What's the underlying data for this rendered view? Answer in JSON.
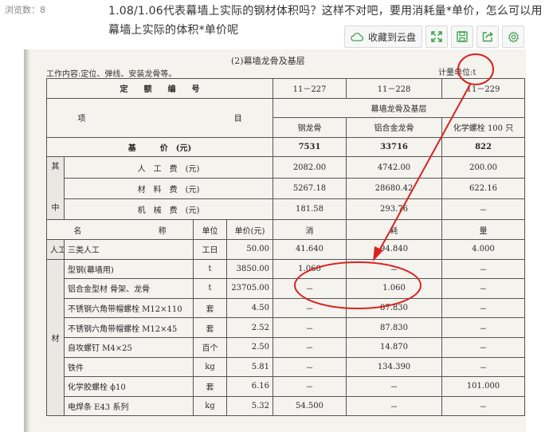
{
  "header": {
    "views": "浏览数：8",
    "question": "1.08/1.06代表幕墙上实际的钢材体积吗？这样不对吧，要用消耗量*单价，怎么可以用幕墙上实际的体积*单价呢"
  },
  "toolbar": {
    "save_cloud_label": "收藏到云盘",
    "icons": [
      "cloud-icon",
      "fullscreen-icon",
      "save-icon",
      "share-icon",
      "settings-icon"
    ],
    "accent_color": "#3fa34d"
  },
  "document": {
    "title": "(2)幕墙龙骨及基层",
    "work_content": "工作内容:定位、弹线、安装龙骨等。",
    "unit": "计量单位:t",
    "table": {
      "code_label": "定　　额　　编　　号",
      "codes": [
        "11－227",
        "11－228",
        "11－229"
      ],
      "item_label": "项",
      "item_label2": "目",
      "group_header": "幕墙龙骨及基层",
      "subheaders": [
        "钢龙骨",
        "铝合金龙骨",
        "化学螺栓 100 只"
      ],
      "base_price_label": "基　　　价　(元)",
      "base_prices": [
        "7531",
        "33716",
        "822"
      ],
      "among_label": [
        "其",
        "中"
      ],
      "cost_rows": [
        {
          "label": "人　工　费　(元)",
          "values": [
            "2082.00",
            "4742.00",
            "200.00"
          ]
        },
        {
          "label": "材　料　费　(元)",
          "values": [
            "5267.18",
            "28680.42",
            "622.16"
          ]
        },
        {
          "label": "机　械　费　(元)",
          "values": [
            "181.58",
            "293.76",
            "－"
          ]
        }
      ],
      "col_headers": {
        "name": "名",
        "name2": "称",
        "unit": "单位",
        "price": "单价(元)",
        "consumption": [
          "消",
          "耗",
          "量"
        ]
      },
      "labor_group": "人工",
      "material_group": "材",
      "labor_rows": [
        {
          "name": "三类人工",
          "unit": "工日",
          "price": "50.00",
          "values": [
            "41.640",
            "94.840",
            "4.000"
          ]
        }
      ],
      "material_rows": [
        {
          "name": "型钢(幕墙用)",
          "unit": "t",
          "price": "3850.00",
          "values": [
            "1.060",
            "－",
            "－"
          ]
        },
        {
          "name": "铝合金型材 骨架、龙骨",
          "unit": "t",
          "price": "23705.00",
          "values": [
            "－",
            "1.060",
            "－"
          ]
        },
        {
          "name": "不锈钢六角带帽螺栓 M12×110",
          "unit": "套",
          "price": "4.50",
          "values": [
            "－",
            "87.830",
            "－"
          ]
        },
        {
          "name": "不锈钢六角带帽螺栓 M12×45",
          "unit": "套",
          "price": "2.52",
          "values": [
            "－",
            "87.830",
            "－"
          ]
        },
        {
          "name": "自攻螺钉 M4×25",
          "unit": "百个",
          "price": "2.50",
          "values": [
            "－",
            "14.870",
            "－"
          ]
        },
        {
          "name": "铁件",
          "unit": "kg",
          "price": "5.81",
          "values": [
            "－",
            "134.390",
            "－"
          ]
        },
        {
          "name": "化学胶螺栓 ϕ10",
          "unit": "套",
          "price": "6.16",
          "values": [
            "－",
            "－",
            "101.000"
          ]
        },
        {
          "name": "电焊条 E43 系列",
          "unit": "kg",
          "price": "5.32",
          "values": [
            "54.500",
            "－",
            "－"
          ]
        }
      ]
    },
    "annotation_color": "#d9231f"
  }
}
